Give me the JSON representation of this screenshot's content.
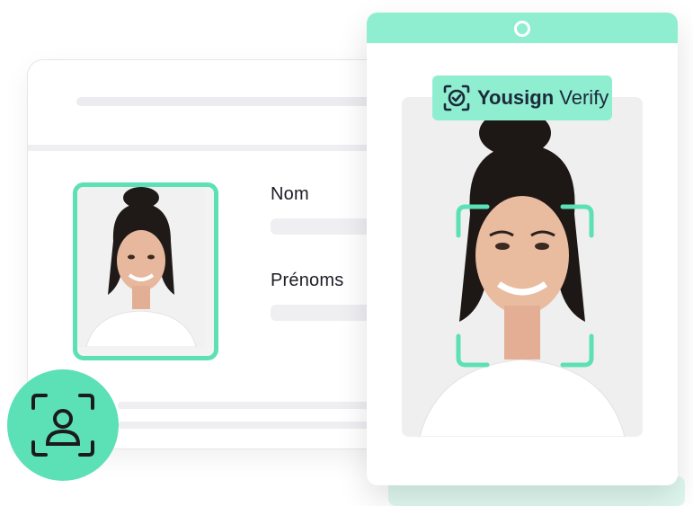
{
  "id_card": {
    "fields": [
      {
        "label": "Nom"
      },
      {
        "label": "Prénoms"
      }
    ]
  },
  "verify": {
    "brand": "Yousign",
    "product": "Verify",
    "icon": "verified-check-icon"
  },
  "colors": {
    "accent": "#5ce0b6",
    "accent_light": "#8fedd0",
    "text": "#1c1c24"
  }
}
